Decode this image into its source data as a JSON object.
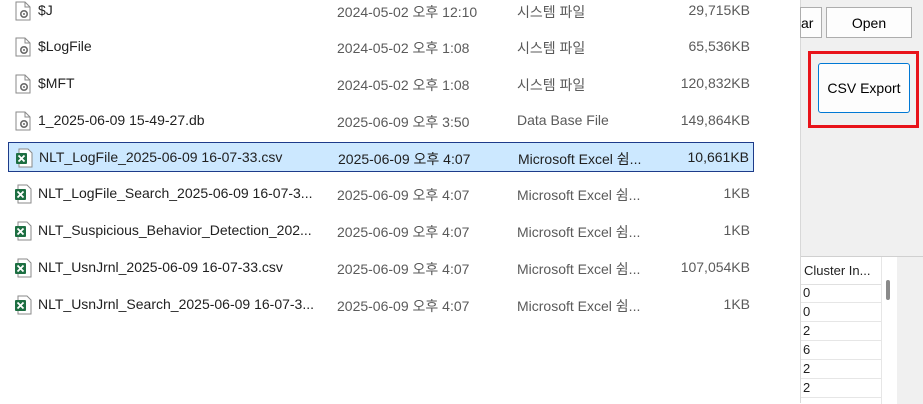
{
  "files": [
    {
      "name": "$J",
      "date": "2024-05-02 오후 12:10",
      "type": "시스템 파일",
      "size": "29,715KB",
      "icon": "system-file-icon",
      "selected": false
    },
    {
      "name": "$LogFile",
      "date": "2024-05-02 오후 1:08",
      "type": "시스템 파일",
      "size": "65,536KB",
      "icon": "system-file-icon",
      "selected": false
    },
    {
      "name": "$MFT",
      "date": "2024-05-02 오후 1:08",
      "type": "시스템 파일",
      "size": "120,832KB",
      "icon": "system-file-icon",
      "selected": false
    },
    {
      "name": "1_2025-06-09 15-49-27.db",
      "date": "2025-06-09 오후 3:50",
      "type": "Data Base File",
      "size": "149,864KB",
      "icon": "system-file-icon",
      "selected": false
    },
    {
      "name": "NLT_LogFile_2025-06-09 16-07-33.csv",
      "date": "2025-06-09 오후 4:07",
      "type": "Microsoft Excel 쉼...",
      "size": "10,661KB",
      "icon": "excel-csv-icon",
      "selected": true
    },
    {
      "name": "NLT_LogFile_Search_2025-06-09 16-07-3...",
      "date": "2025-06-09 오후 4:07",
      "type": "Microsoft Excel 쉼...",
      "size": "1KB",
      "icon": "excel-csv-icon",
      "selected": false
    },
    {
      "name": "NLT_Suspicious_Behavior_Detection_202...",
      "date": "2025-06-09 오후 4:07",
      "type": "Microsoft Excel 쉼...",
      "size": "1KB",
      "icon": "excel-csv-icon",
      "selected": false
    },
    {
      "name": "NLT_UsnJrnl_2025-06-09 16-07-33.csv",
      "date": "2025-06-09 오후 4:07",
      "type": "Microsoft Excel 쉼...",
      "size": "107,054KB",
      "icon": "excel-csv-icon",
      "selected": false
    },
    {
      "name": "NLT_UsnJrnl_Search_2025-06-09 16-07-3...",
      "date": "2025-06-09 오후 4:07",
      "type": "Microsoft Excel 쉼...",
      "size": "1KB",
      "icon": "excel-csv-icon",
      "selected": false
    }
  ],
  "panel": {
    "clear_label": "ar",
    "open_label": "Open",
    "export_label": "CSV Export",
    "highlight_color": "#e8131a"
  },
  "grid": {
    "header": "Cluster In...",
    "values": [
      "0",
      "0",
      "2",
      "6",
      "2",
      "2"
    ]
  }
}
